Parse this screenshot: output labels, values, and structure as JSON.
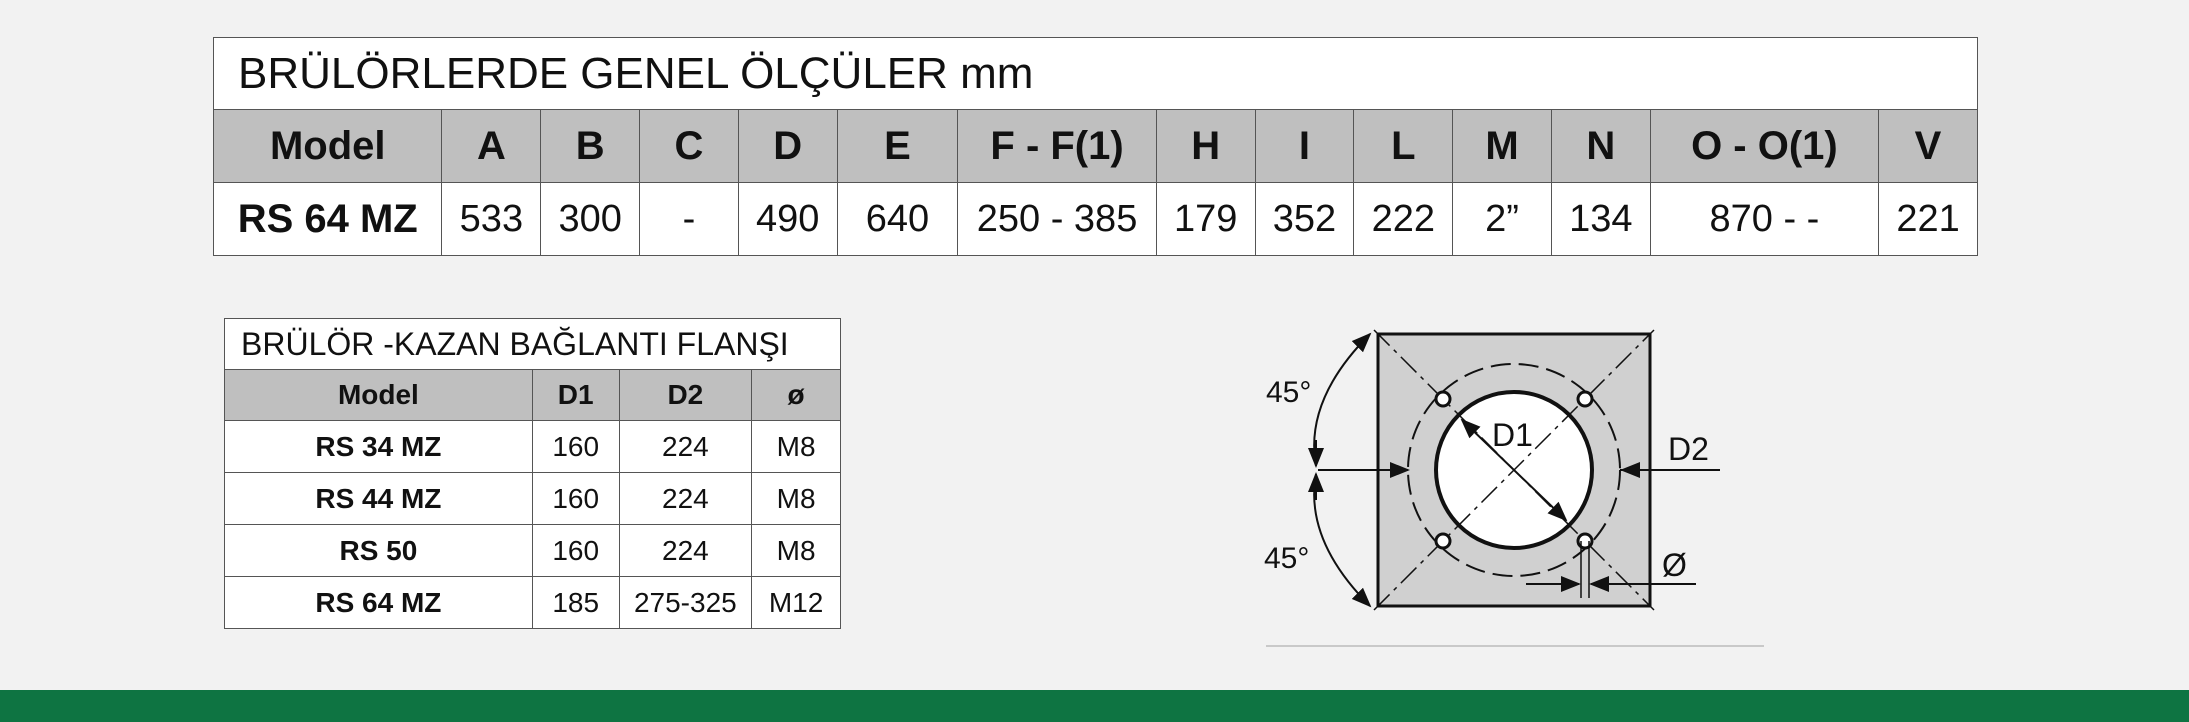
{
  "dimensions_table": {
    "title": "BRÜLÖRLERDE GENEL ÖLÇÜLER mm",
    "headers": [
      "Model",
      "A",
      "B",
      "C",
      "D",
      "E",
      "F - F(1)",
      "H",
      "I",
      "L",
      "M",
      "N",
      "O - O(1)",
      "V"
    ],
    "row": [
      "RS 64 MZ",
      "533",
      "300",
      "-",
      "490",
      "640",
      "250 - 385",
      "179",
      "352",
      "222",
      "2”",
      "134",
      "870 -  -",
      "221"
    ]
  },
  "flange_table": {
    "title": "BRÜLÖR -KAZAN BAĞLANTI FLANŞI",
    "headers": [
      "Model",
      "D1",
      "D2",
      "ø"
    ],
    "rows": [
      [
        "RS 34 MZ",
        "160",
        "224",
        "M8"
      ],
      [
        "RS 44 MZ",
        "160",
        "224",
        "M8"
      ],
      [
        "RS 50",
        "160",
        "224",
        "M8"
      ],
      [
        "RS 64 MZ",
        "185",
        "275-325",
        "M12"
      ]
    ]
  },
  "diagram": {
    "angle_top": "45°",
    "angle_bottom": "45°",
    "label_d1": "D1",
    "label_d2": "D2",
    "label_phi": "Ø"
  },
  "colors": {
    "header_gray": "#bfbfbf",
    "panel_gray": "#d0d0d0",
    "footer_green": "#0e7442"
  }
}
